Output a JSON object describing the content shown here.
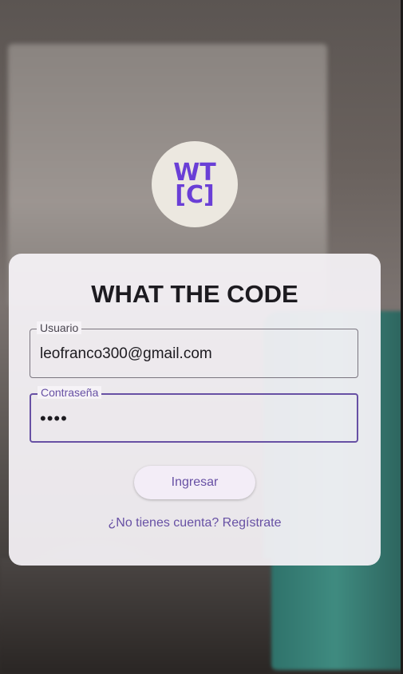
{
  "logo": {
    "line1": "WT",
    "line2": "[C]"
  },
  "login": {
    "title": "WHAT THE CODE",
    "user_label": "Usuario",
    "user_value": "leofranco300@gmail.com",
    "password_label": "Contraseña",
    "password_value": "••••",
    "submit_label": "Ingresar",
    "register_link": "¿No tienes cuenta? Regístrate"
  },
  "colors": {
    "accent": "#6750a4",
    "logo_text": "#6a3fd6",
    "card_bg": "#f6f3f7"
  }
}
